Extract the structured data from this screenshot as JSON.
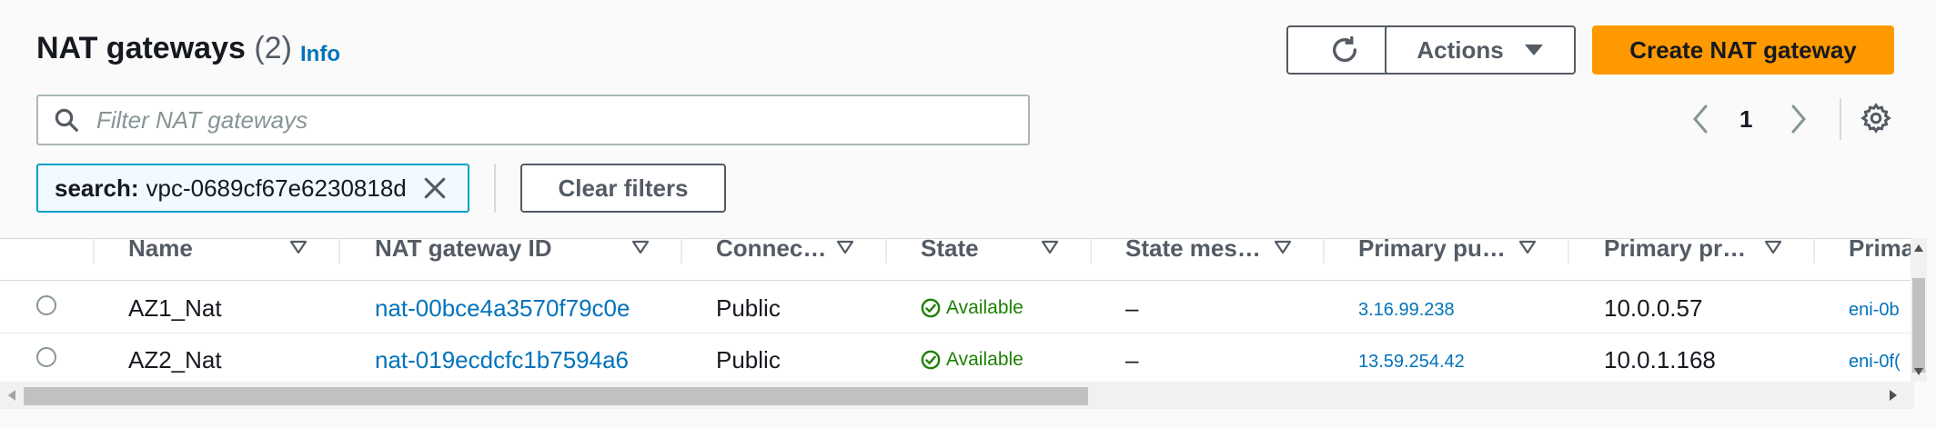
{
  "header": {
    "title": "NAT gateways",
    "count": "(2)",
    "info_link": "Info"
  },
  "toolbar": {
    "refresh_icon": "refresh-icon",
    "actions_label": "Actions",
    "create_label": "Create NAT gateway"
  },
  "filter": {
    "placeholder": "Filter NAT gateways",
    "token_key": "search:",
    "token_value": "vpc-0689cf67e6230818d",
    "clear_label": "Clear filters"
  },
  "pagination": {
    "current_page": "1"
  },
  "table": {
    "columns": [
      "Name",
      "NAT gateway ID",
      "Connec…",
      "State",
      "State mes…",
      "Primary pu…",
      "Primary pr…",
      "Prima"
    ],
    "rows": [
      {
        "name": "AZ1_Nat",
        "id": "nat-00bce4a3570f79c0e",
        "connectivity": "Public",
        "state": "Available",
        "state_message": "–",
        "public_ip": "3.16.99.238",
        "private_ip": "10.0.0.57",
        "eni": "eni-0b"
      },
      {
        "name": "AZ2_Nat",
        "id": "nat-019ecdcfc1b7594a6",
        "connectivity": "Public",
        "state": "Available",
        "state_message": "–",
        "public_ip": "13.59.254.42",
        "private_ip": "10.0.1.168",
        "eni": "eni-0f("
      }
    ]
  },
  "colors": {
    "primary": "#ff9900",
    "link": "#0073bb",
    "success": "#1d8102",
    "border": "#aab7b8"
  }
}
